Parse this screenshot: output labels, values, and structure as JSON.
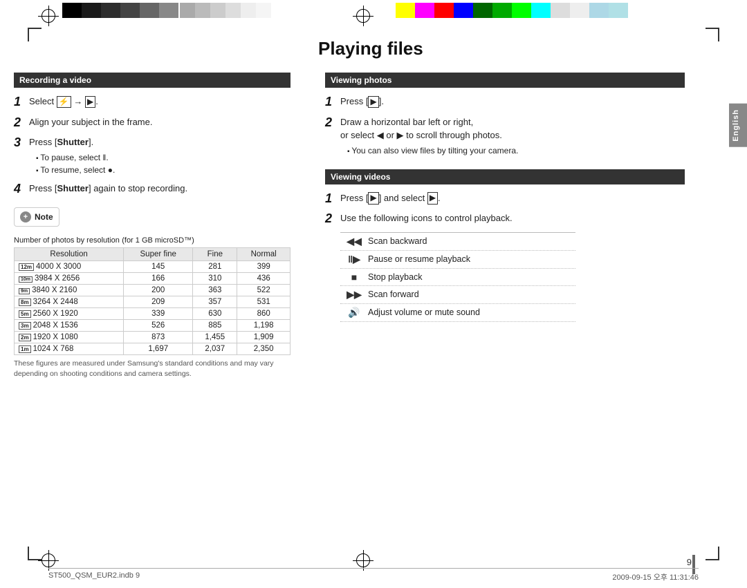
{
  "page": {
    "title": "Playing files",
    "number": "9",
    "footer_left": "ST500_QSM_EUR2.indb   9",
    "footer_right": "2009-09-15   오후 11:31:46",
    "english_tab": "English"
  },
  "left_section": {
    "header": "Recording a video",
    "steps": [
      {
        "number": "1",
        "text": "Select",
        "icon_camera": "⊙",
        "arrow": "→",
        "icon_video": "🎥"
      },
      {
        "number": "2",
        "text": "Align your subject in the frame."
      },
      {
        "number": "3",
        "text": "Press [Shutter].",
        "bullets": [
          "To pause, select ‖.",
          "To resume, select ●."
        ]
      },
      {
        "number": "4",
        "text": "Press [Shutter] again to stop recording."
      }
    ],
    "note_label": "Note",
    "table_title": "Number of photos by resolution",
    "table_subtitle": "(for 1 GB microSD™)",
    "table_headers": [
      "Resolution",
      "Super fine",
      "Fine",
      "Normal"
    ],
    "table_rows": [
      {
        "icon": "12m",
        "res": "4000 X 3000",
        "sf": "145",
        "fine": "281",
        "normal": "399"
      },
      {
        "icon": "10m",
        "res": "3984 X 2656",
        "sf": "166",
        "fine": "310",
        "normal": "436"
      },
      {
        "icon": "9m",
        "res": "3840 X 2160",
        "sf": "200",
        "fine": "363",
        "normal": "522"
      },
      {
        "icon": "8m",
        "res": "3264 X 2448",
        "sf": "209",
        "fine": "357",
        "normal": "531"
      },
      {
        "icon": "5m",
        "res": "2560 X 1920",
        "sf": "339",
        "fine": "630",
        "normal": "860"
      },
      {
        "icon": "3m",
        "res": "2048 X 1536",
        "sf": "526",
        "fine": "885",
        "normal": "1,198"
      },
      {
        "icon": "2m",
        "res": "1920 X 1080",
        "sf": "873",
        "fine": "1,455",
        "normal": "1,909"
      },
      {
        "icon": "1m",
        "res": "1024 X 768",
        "sf": "1,697",
        "fine": "2,037",
        "normal": "2,350"
      }
    ],
    "table_note": "These figures are measured under Samsung's standard conditions and may\nvary depending on shooting conditions and camera settings."
  },
  "right_section": {
    "viewing_photos": {
      "header": "Viewing photos",
      "steps": [
        {
          "number": "1",
          "text": "Press [▶]."
        },
        {
          "number": "2",
          "text": "Draw a horizontal bar left or right,\nor select ◀ or ▶ to scroll through photos.",
          "bullets": [
            "You can also view files by tilting your camera."
          ]
        }
      ]
    },
    "viewing_videos": {
      "header": "Viewing videos",
      "steps": [
        {
          "number": "1",
          "text": "Press [▶] and select ▶."
        },
        {
          "number": "2",
          "text": "Use the following icons to control playback."
        }
      ],
      "icons_table": [
        {
          "icon": "◀◀",
          "label": "Scan backward"
        },
        {
          "icon": "‖▶",
          "label": "Pause or resume playback"
        },
        {
          "icon": "■",
          "label": "Stop playback"
        },
        {
          "icon": "▶▶",
          "label": "Scan forward"
        },
        {
          "icon": "🔊",
          "label": "Adjust volume or mute sound"
        }
      ]
    }
  }
}
